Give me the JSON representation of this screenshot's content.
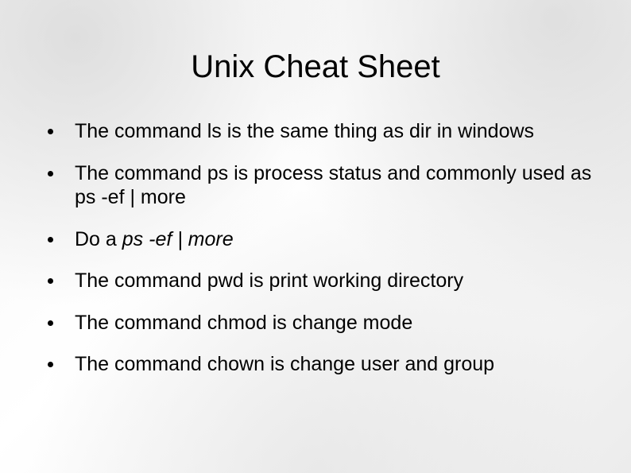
{
  "title": "Unix Cheat Sheet",
  "bullets": [
    "The command ls is the same thing as dir in windows",
    "The command ps is process status and commonly used as ps -ef | more",
    {
      "pre": "Do a ",
      "italic": "ps -ef | more"
    },
    "The command pwd is print working directory",
    "The command chmod is change mode",
    "The command chown is change user and group"
  ]
}
